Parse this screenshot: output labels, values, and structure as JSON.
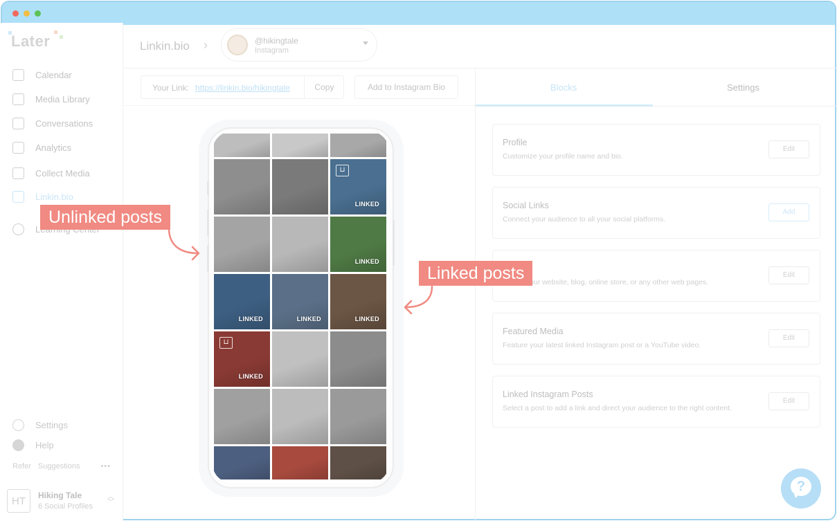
{
  "app": {
    "logo": "Later"
  },
  "sidebar": {
    "items": [
      {
        "label": "Calendar"
      },
      {
        "label": "Media Library"
      },
      {
        "label": "Conversations"
      },
      {
        "label": "Analytics"
      },
      {
        "label": "Collect Media"
      },
      {
        "label": "Linkin.bio"
      },
      {
        "label": "Learning Center"
      }
    ],
    "settings": "Settings",
    "help": "Help",
    "refer": "Refer",
    "suggestions": "Suggestions",
    "more": "•••",
    "profile": {
      "initials": "HT",
      "name": "Hiking Tale",
      "sub": "6 Social Profiles"
    }
  },
  "header": {
    "breadcrumb": "Linkin.bio",
    "account": {
      "handle": "@hikingtale",
      "network": "Instagram"
    }
  },
  "toolbar": {
    "link_label": "Your Link:",
    "link_url": "https://linkin.bio/hikingtale",
    "copy": "Copy",
    "add_bio": "Add to Instagram Bio"
  },
  "panel": {
    "tabs": [
      {
        "label": "Blocks"
      },
      {
        "label": "Settings"
      }
    ],
    "cards": [
      {
        "title": "Profile",
        "desc": "Customize your profile name and bio.",
        "button": "Edit"
      },
      {
        "title": "Social Links",
        "desc": "Connect your audience to all your social platforms.",
        "button": "Add"
      },
      {
        "title": "",
        "desc": "Link to your website, blog, online store, or any other web pages.",
        "button": "Edit"
      },
      {
        "title": "Featured Media",
        "desc": "Feature your latest linked Instagram post or a YouTube video.",
        "button": "Edit"
      },
      {
        "title": "Linked Instagram Posts",
        "desc": "Select a post to add a link and direct your audience to the right content.",
        "button": "Edit"
      }
    ]
  },
  "grid": {
    "linked_label": "LINKED",
    "tiles": [
      {
        "linked": false,
        "cart": false,
        "color": "#bdbdbd"
      },
      {
        "linked": false,
        "cart": false,
        "color": "#c8c8c8"
      },
      {
        "linked": false,
        "cart": false,
        "color": "#a8a8a8"
      },
      {
        "linked": false,
        "cart": false,
        "color": "#8e8e8e"
      },
      {
        "linked": false,
        "cart": false,
        "color": "#7a7a7a"
      },
      {
        "linked": true,
        "cart": true,
        "color": "#4a6f90"
      },
      {
        "linked": false,
        "cart": false,
        "color": "#a4a4a4"
      },
      {
        "linked": false,
        "cart": false,
        "color": "#b8b8b8"
      },
      {
        "linked": true,
        "cart": false,
        "color": "#4f7a45"
      },
      {
        "linked": true,
        "cart": false,
        "color": "#3d5f82"
      },
      {
        "linked": true,
        "cart": false,
        "color": "#5b7088"
      },
      {
        "linked": true,
        "cart": false,
        "color": "#6b5544"
      },
      {
        "linked": true,
        "cart": true,
        "color": "#8a3a34"
      },
      {
        "linked": false,
        "cart": false,
        "color": "#c0c0c0"
      },
      {
        "linked": false,
        "cart": false,
        "color": "#8c8c8c"
      },
      {
        "linked": false,
        "cart": false,
        "color": "#a0a0a0"
      },
      {
        "linked": false,
        "cart": false,
        "color": "#bcbcbc"
      },
      {
        "linked": false,
        "cart": false,
        "color": "#9a9a9a"
      },
      {
        "linked": false,
        "cart": false,
        "color": "#4d5f80"
      },
      {
        "linked": false,
        "cart": false,
        "color": "#a84a3e"
      },
      {
        "linked": false,
        "cart": false,
        "color": "#5e5046"
      }
    ]
  },
  "callouts": {
    "unlinked": "Unlinked posts",
    "linked": "Linked posts"
  },
  "help_fab": "?"
}
